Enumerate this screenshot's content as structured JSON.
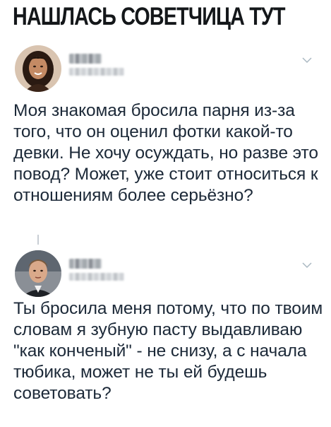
{
  "headline": "НАШЛАСЬ СОВЕТЧИЦА ТУТ",
  "posts": [
    {
      "text": "Моя знакомая бросила парня из-за того, что он оценил фотки какой-то девки. Не хочу осуждать, но разве это повод? Может, уже стоит относиться к отношениям более серьёзно?",
      "avatar": "woman-portrait",
      "menu_icon": "chevron-down-icon"
    },
    {
      "text": "Ты бросила меня потому, что по твоим словам я зубную пасту выдавливаю \"как конченый\" - не снизу, а с начала тюбика, может не ты ей будешь советовать?",
      "avatar": "man-portrait",
      "menu_icon": "chevron-down-icon"
    }
  ],
  "colors": {
    "text": "#1c2938",
    "headline": "#14171a",
    "chevron": "#aab8c2"
  }
}
